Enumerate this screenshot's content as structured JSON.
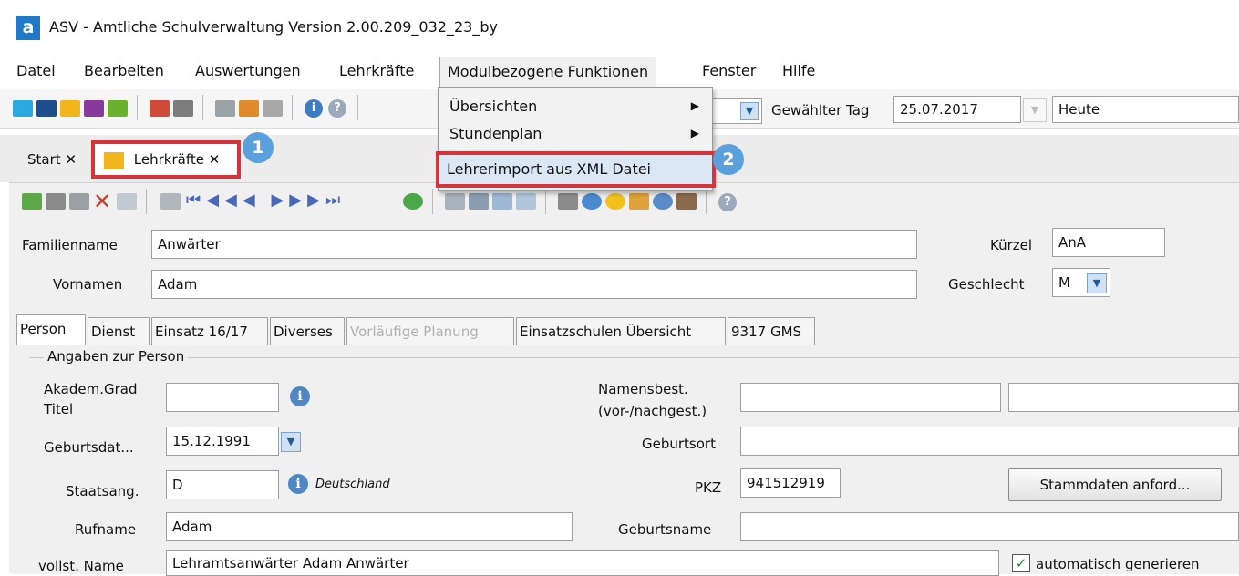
{
  "window": {
    "title": "ASV - Amtliche Schulverwaltung Version 2.00.209_032_23_by",
    "logo_letter": "a"
  },
  "menubar": {
    "items": [
      "Datei",
      "Bearbeiten",
      "Auswertungen",
      "Lehrkräfte",
      "Modulbezogene Funktionen",
      "Fenster",
      "Hilfe"
    ]
  },
  "dropdown": {
    "items": [
      {
        "label": "Übersichten",
        "submenu": "▶"
      },
      {
        "label": "Stundenplan",
        "submenu": "▶"
      },
      {
        "label": "Lehrerimport aus XML Datei",
        "submenu": ""
      }
    ]
  },
  "toolbar": {
    "selected_day_label": "Gewählter Tag",
    "selected_day_value": "25.07.2017",
    "today_value": "Heute"
  },
  "tabs": [
    {
      "label": "Start",
      "close": "✕"
    },
    {
      "label": "Lehrkräfte",
      "close": "✕"
    }
  ],
  "badges": [
    "1",
    "2"
  ],
  "header_form": {
    "familienname_label": "Familienname",
    "familienname_value": "Anwärter",
    "kuerzel_label": "Kürzel",
    "kuerzel_value": "AnA",
    "vornamen_label": "Vornamen",
    "vornamen_value": "Adam",
    "geschlecht_label": "Geschlecht",
    "geschlecht_value": "M"
  },
  "detail_tabs": [
    "Person",
    "Dienst",
    "Einsatz 16/17",
    "Diverses",
    "Vorläufige Planung",
    "Einsatzschulen Übersicht",
    "9317 GMS"
  ],
  "person": {
    "group_title": "Angaben zur Person",
    "akadem_label_1": "Akadem.Grad",
    "akadem_label_2": "Titel",
    "akadem_value": "",
    "namensbest_label_1": "Namensbest.",
    "namensbest_label_2": "(vor-/nachgest.)",
    "namensbest_value_1": "",
    "namensbest_value_2": "",
    "geburtsdat_label": "Geburtsdat...",
    "geburtsdat_value": "15.12.1991",
    "geburtsort_label": "Geburtsort",
    "geburtsort_value": "",
    "staatsang_label": "Staatsang.",
    "staatsang_value": "D",
    "staatsang_text": "Deutschland",
    "pkz_label": "PKZ",
    "pkz_value": "941512919",
    "stammdaten_button": "Stammdaten anford...",
    "rufname_label": "Rufname",
    "rufname_value": "Adam",
    "geburtsname_label": "Geburtsname",
    "geburtsname_value": "",
    "vollst_name_label": "vollst. Name",
    "vollst_name_value": "Lehramtsanwärter Adam Anwärter",
    "auto_generate_label": "automatisch generieren",
    "auto_generate_check": "✓"
  },
  "icons": {
    "info": "i",
    "dropdown_arrow": "▼"
  }
}
